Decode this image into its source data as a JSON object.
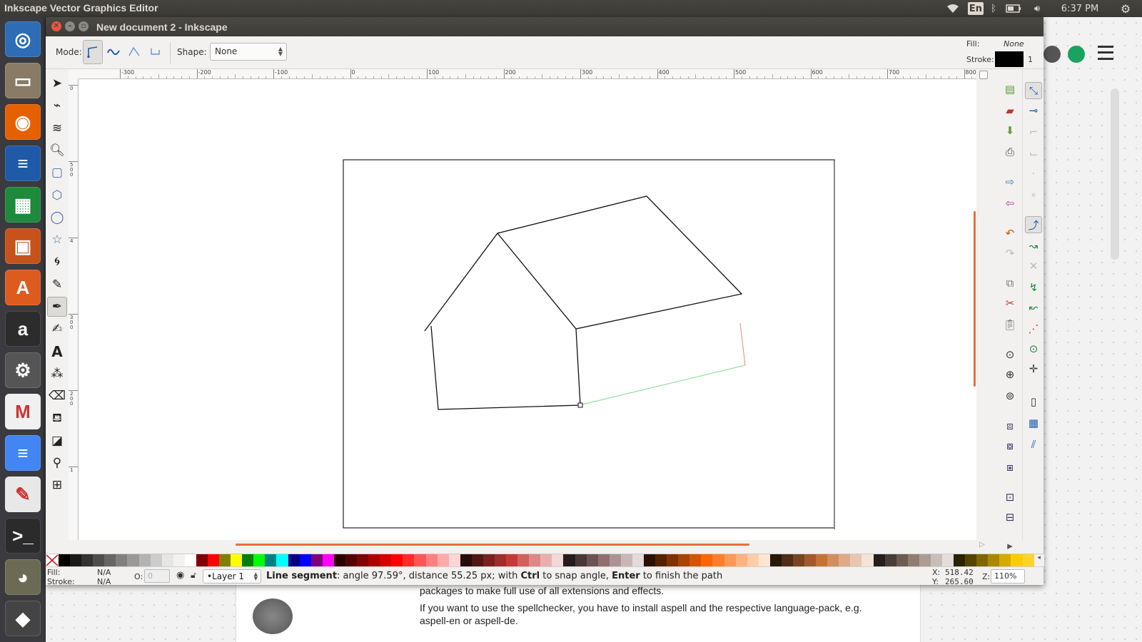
{
  "topbar": {
    "app_title": "Inkscape Vector Graphics Editor",
    "keyboard": "En",
    "time": "6:37 PM"
  },
  "launcher": {
    "items": [
      {
        "name": "ubuntu-dash",
        "glyph": "◎",
        "color": "#2d6db5"
      },
      {
        "name": "files",
        "glyph": "▭",
        "color": "#8a7b66"
      },
      {
        "name": "firefox",
        "glyph": "◉",
        "color": "#e66000"
      },
      {
        "name": "libreoffice-writer",
        "glyph": "≡",
        "color": "#1e5aa8"
      },
      {
        "name": "libreoffice-calc",
        "glyph": "▦",
        "color": "#1e8a3c"
      },
      {
        "name": "libreoffice-impress",
        "glyph": "▣",
        "color": "#c5531b"
      },
      {
        "name": "software-center",
        "glyph": "A",
        "color": "#dd5b1f"
      },
      {
        "name": "amazon",
        "glyph": "a",
        "color": "#2c2c2c"
      },
      {
        "name": "system-settings",
        "glyph": "⚙",
        "color": "#555"
      },
      {
        "name": "gmail",
        "glyph": "M",
        "color": "#f0f0f0"
      },
      {
        "name": "google-docs",
        "glyph": "≡",
        "color": "#4285f4"
      },
      {
        "name": "text-editor",
        "glyph": "✎",
        "color": "#e8e8e8"
      },
      {
        "name": "terminal",
        "glyph": ">_",
        "color": "#2b2b2b"
      },
      {
        "name": "gimp",
        "glyph": "◕",
        "color": "#6b6b55"
      },
      {
        "name": "inkscape",
        "glyph": "◆",
        "color": "#444"
      }
    ]
  },
  "background_window": {
    "line1": "packages to make full use of all extensions and effects.",
    "line2": "If you want to use the spellchecker, you have to install aspell and the respective language-pack, e.g.",
    "line3": "aspell-en or aspell-de."
  },
  "window": {
    "title": "New document 2 - Inkscape"
  },
  "controls": {
    "mode_label": "Mode:",
    "shape_label": "Shape:",
    "shape_value": "None"
  },
  "fill_stroke": {
    "fill_label": "Fill:",
    "fill_value": "None",
    "stroke_label": "Stroke:",
    "stroke_width": "1",
    "stroke_color": "#000000"
  },
  "ruler_labels": [
    "-300",
    "-200",
    "-100",
    "0",
    "100",
    "200",
    "300",
    "400",
    "500",
    "600",
    "700",
    "800"
  ],
  "vruler_labels": [
    "0",
    "5 0 0",
    "4",
    "3 0 0",
    "2 0 0",
    "1",
    "0"
  ],
  "status": {
    "fill_label": "Fill:",
    "fill_value": "N/A",
    "stroke_label": "Stroke:",
    "stroke_value": "N/A",
    "opacity_label": "O:",
    "opacity_value": "0",
    "layer": "•Layer 1",
    "message_bold": "Line segment",
    "message_rest": ": angle 97.59°, distance 55.25 px; with ",
    "key1": "Ctrl",
    "message_mid": " to snap angle, ",
    "key2": "Enter",
    "message_end": " to finish the path",
    "x_label": "X:",
    "x_value": "518.42",
    "y_label": "Y:",
    "y_value": "265.60",
    "zoom_label": "Z:",
    "zoom_value": "110%"
  },
  "palette": [
    "#000000",
    "#1a1a1a",
    "#333333",
    "#4d4d4d",
    "#666666",
    "#808080",
    "#999999",
    "#b3b3b3",
    "#cccccc",
    "#e6e6e6",
    "#f2f2f2",
    "#ffffff",
    "#800000",
    "#ff0000",
    "#808000",
    "#ffff00",
    "#008000",
    "#00ff00",
    "#008080",
    "#00ffff",
    "#000080",
    "#0000ff",
    "#800080",
    "#ff00ff",
    "#2b0000",
    "#550000",
    "#800000",
    "#aa0000",
    "#d40000",
    "#ff0000",
    "#ff2a2a",
    "#ff5555",
    "#ff8080",
    "#ffaaaa",
    "#ffd5d5",
    "#280b0b",
    "#501616",
    "#782121",
    "#a02c2c",
    "#c83737",
    "#d35f5f",
    "#de8787",
    "#e9afaf",
    "#f4d7d7",
    "#241c1c",
    "#483737",
    "#6c5353",
    "#916f6f",
    "#ac9393",
    "#c8b7b7",
    "#e3dbdb",
    "#2b1100",
    "#552200",
    "#803300",
    "#aa4400",
    "#d45500",
    "#ff6600",
    "#ff7f2a",
    "#ff9955",
    "#ffb380",
    "#ffccaa",
    "#ffe6d5",
    "#28170b",
    "#502d16",
    "#784421",
    "#a05a2c",
    "#c87137",
    "#d38d5f",
    "#deaa87",
    "#e9c6af",
    "#f4e3d7",
    "#241f1c",
    "#483e37",
    "#6c5d53",
    "#917c6f",
    "#ac9d93",
    "#c8beb7",
    "#e3dedb",
    "#2b2200",
    "#554400",
    "#806600",
    "#aa8800",
    "#d4aa00",
    "#ffcc00",
    "#ffd42a"
  ]
}
